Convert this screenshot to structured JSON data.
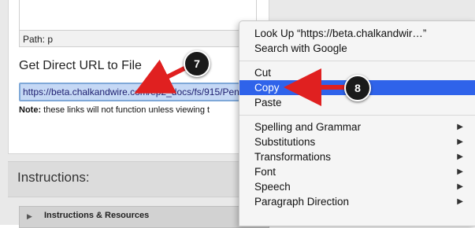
{
  "editor": {
    "path_label": "Path: p"
  },
  "direct_url": {
    "title": "Get Direct URL to File",
    "url_value": "https://beta.chalkandwire.com/ep2_docs/fs/915/Pen",
    "note_bold": "Note:",
    "note_text": " these links will not function unless viewing t"
  },
  "instructions": {
    "title": "Instructions:",
    "resources_label": "Instructions & Resources"
  },
  "context_menu": {
    "look_up": "Look Up “https://beta.chalkandwir…”",
    "search_google": "Search with Google",
    "cut": "Cut",
    "copy": "Copy",
    "paste": "Paste",
    "spelling": "Spelling and Grammar",
    "substitutions": "Substitutions",
    "transformations": "Transformations",
    "font": "Font",
    "speech": "Speech",
    "paragraph_direction": "Paragraph Direction"
  },
  "annotations": {
    "step_7": "7",
    "step_8": "8",
    "arrow_color": "#e02020"
  }
}
